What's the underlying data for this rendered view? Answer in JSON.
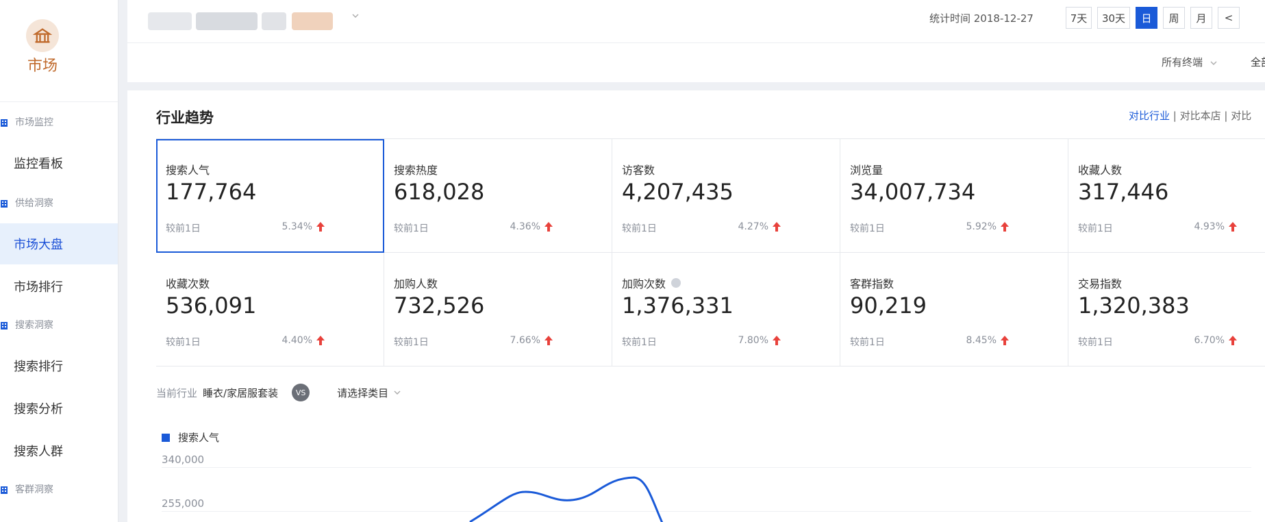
{
  "sidebar": {
    "logo_text": "市场",
    "logo_icon": "market-icon",
    "nav": [
      {
        "type": "section",
        "label": "市场监控"
      },
      {
        "type": "item",
        "label": "监控看板"
      },
      {
        "type": "section",
        "label": "供给洞察"
      },
      {
        "type": "item",
        "label": "市场大盘",
        "active": true
      },
      {
        "type": "item",
        "label": "市场排行"
      },
      {
        "type": "section",
        "label": "搜索洞察"
      },
      {
        "type": "item",
        "label": "搜索排行"
      },
      {
        "type": "item",
        "label": "搜索分析"
      },
      {
        "type": "item",
        "label": "搜索人群"
      },
      {
        "type": "section",
        "label": "客群洞察"
      }
    ]
  },
  "topbar": {
    "stat_time": "统计时间 2018-12-27",
    "ranges": [
      "7天",
      "30天",
      "日",
      "周",
      "月",
      "<"
    ],
    "selected_range": "日",
    "terminal": "所有终端",
    "all": "全部"
  },
  "card": {
    "title": "行业趋势",
    "compare": {
      "active": "对比行业",
      "sep": " | ",
      "item2": "对比本店",
      "item3": "对比"
    },
    "metrics": [
      {
        "label": "搜索人气",
        "value": "177,764",
        "prev": "较前1日",
        "pct": "5.34%",
        "highlighted": true
      },
      {
        "label": "搜索热度",
        "value": "618,028",
        "prev": "较前1日",
        "pct": "4.36%"
      },
      {
        "label": "访客数",
        "value": "4,207,435",
        "prev": "较前1日",
        "pct": "4.27%"
      },
      {
        "label": "浏览量",
        "value": "34,007,734",
        "prev": "较前1日",
        "pct": "5.92%"
      },
      {
        "label": "收藏人数",
        "value": "317,446",
        "prev": "较前1日",
        "pct": "4.93%"
      },
      {
        "label": "收藏次数",
        "value": "536,091",
        "prev": "较前1日",
        "pct": "4.40%"
      },
      {
        "label": "加购人数",
        "value": "732,526",
        "prev": "较前1日",
        "pct": "7.66%"
      },
      {
        "label": "加购次数",
        "value": "1,376,331",
        "prev": "较前1日",
        "pct": "7.80%",
        "info": true
      },
      {
        "label": "客群指数",
        "value": "90,219",
        "prev": "较前1日",
        "pct": "8.45%"
      },
      {
        "label": "交易指数",
        "value": "1,320,383",
        "prev": "较前1日",
        "pct": "6.70%"
      }
    ],
    "industry": {
      "label": "当前行业",
      "value": "睡衣/家居服套装",
      "vs": "VS",
      "select": "请选择类目"
    }
  },
  "colors": {
    "accent": "#1a5ad8",
    "up": "#e8413b",
    "brand": "#c06a2c"
  },
  "chart_data": {
    "type": "line",
    "legend": [
      "搜索人气"
    ],
    "yticks": [
      "340,000",
      "255,000"
    ],
    "series": [
      {
        "name": "搜索人气",
        "values": [],
        "note_visible_partial": true
      }
    ]
  }
}
